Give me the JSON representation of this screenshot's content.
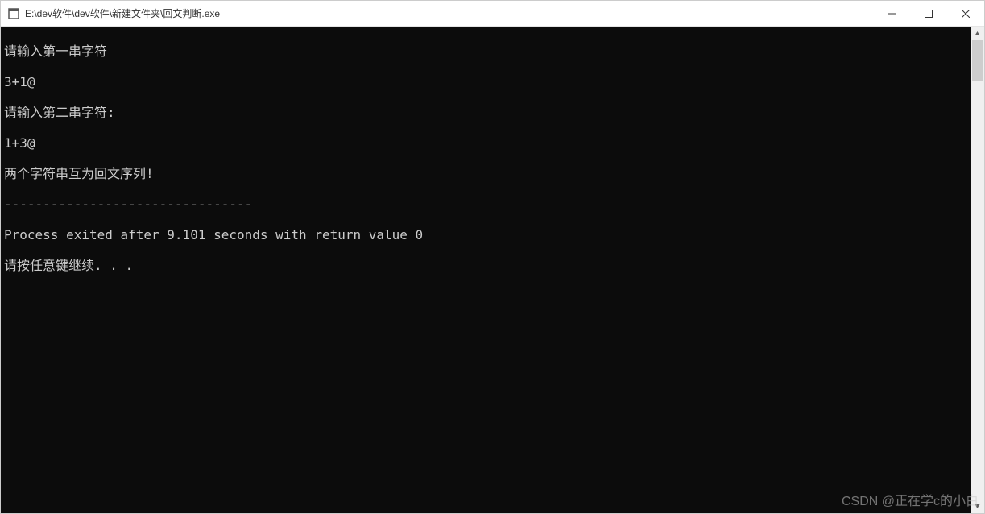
{
  "window": {
    "title": "E:\\dev软件\\dev软件\\新建文件夹\\回文判断.exe"
  },
  "console": {
    "lines": [
      "请输入第一串字符",
      "3+1@",
      "请输入第二串字符:",
      "1+3@",
      "两个字符串互为回文序列!",
      "--------------------------------",
      "Process exited after 9.101 seconds with return value 0",
      "请按任意键继续. . ."
    ]
  },
  "watermark": "CSDN @正在学c的小白"
}
